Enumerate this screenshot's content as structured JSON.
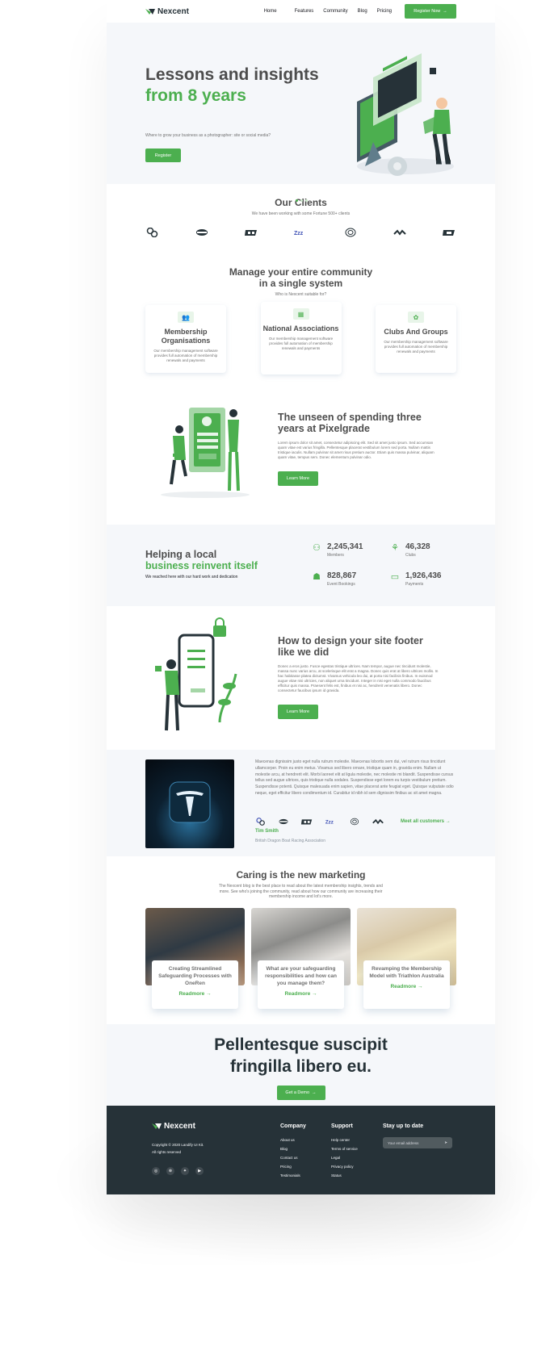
{
  "brand": {
    "name": "Nexcent",
    "accent": "#4caf4f",
    "dark": "#263238"
  },
  "nav": {
    "items": [
      "Home",
      "Features",
      "Community",
      "Blog",
      "Pricing"
    ],
    "cta": "Register Now"
  },
  "hero": {
    "line1": "Lessons and insights",
    "line2": "from 8 years",
    "subtitle": "Where to grow your business as a photographer: site or social media?",
    "button": "Register"
  },
  "clients": {
    "title": "Our Clients",
    "subtitle": "We have been working with some Fortune 500+ clients"
  },
  "community": {
    "title_line1": "Manage your entire community",
    "title_line2": "in a single system",
    "subtitle": "Who is Nexcent suitable for?",
    "cards": [
      {
        "title": "Membership Organisations",
        "desc": "Our membership management software provides full automation of membership renewals and payments"
      },
      {
        "title": "National Associations",
        "desc": "Our membership management software provides full automation of membership renewals and payments"
      },
      {
        "title": "Clubs And Groups",
        "desc": "Our membership management software provides full automation of membership renewals and payments"
      }
    ]
  },
  "feature1": {
    "title": "The unseen of spending three years at Pixelgrade",
    "body": "Lorem ipsum dolor sit amet, consectetur adipiscing elit. Sed sit amet justo ipsum. Sed accumsan quam vitae est varius fringilla. Pellentesque placerat vestibulum lorem sed porta. Nullam mattis tristique iaculis. Nullam pulvinar sit amet risus pretium auctor. Etiam quis massa pulvinar, aliquam quam vitae, tempus sem. Donec elementum pulvinar odio.",
    "button": "Learn More"
  },
  "stats": {
    "title_a": "Helping a local",
    "title_b": "business reinvent itself",
    "subtitle": "We reached here with our hard work and dedication",
    "items": [
      {
        "value": "2,245,341",
        "label": "Members"
      },
      {
        "value": "46,328",
        "label": "Clubs"
      },
      {
        "value": "828,867",
        "label": "Event Bookings"
      },
      {
        "value": "1,926,436",
        "label": "Payments"
      }
    ]
  },
  "feature2": {
    "title": "How to design your site footer like we did",
    "body": "Donec a eros justo. Fusce egestas tristique ultrices. Nam tempor, augue nec tincidunt molestie, massa nunc varius arcu, at scelerisque elit erat a magna. Donec quis erat at libero ultrices mollis. In hac habitasse platea dictumst. Vivamus vehicula leo dui, at porta nisi facilisis finibus. In euismod augue vitae nisi ultricies, non aliquet urna tincidunt. Integer in nisi eget nulla commodo faucibus efficitur quis massa. Praesent felis est, finibus et nisi ac, hendrerit venenatis libero. Donec consectetur faucibus ipsum id gravida.",
    "button": "Learn More"
  },
  "testimonial": {
    "quote": "Maecenas dignissim justo eget nulla rutrum molestie. Maecenas lobortis sem dui, vel rutrum risus tincidunt ullamcorper. Proin eu enim metus. Vivamus sed libero ornare, tristique quam in, gravida enim. Nullam ut molestie arcu, at hendrerit elit. Morbi laoreet elit at ligula molestie, nec molestie mi blandit. Suspendisse cursus tellus sed augue ultrices, quis tristique nulla sodales. Suspendisse eget lorem eu turpis vestibulum pretium. Suspendisse potenti. Quisque malesuada enim sapien, vitae placerat ante feugiat eget. Quisque vulputate odio neque, eget efficitur libero condimentum id. Curabitur id nibh id sem dignissim finibus ac sit amet magna.",
    "name": "Tim Smith",
    "company": "British Dragon Boat Racing Association",
    "link": "Meet all customers"
  },
  "blog": {
    "title": "Caring is the new marketing",
    "subtitle": "The Nexcent blog is the best place to read about the latest membership insights, trends and more. See who's joining the community, read about how our community are increasing their membership income and lot's more.",
    "posts": [
      {
        "title": "Creating Streamlined Safeguarding Processes with OneRen",
        "link": "Readmore"
      },
      {
        "title": "What are your safeguarding responsibilities and how can you manage them?",
        "link": "Readmore"
      },
      {
        "title": "Revamping the Membership Model with Triathlon Australia",
        "link": "Readmore"
      }
    ]
  },
  "cta": {
    "line1": "Pellentesque suscipit",
    "line2": "fringilla libero eu.",
    "button": "Get a Demo"
  },
  "footer": {
    "logo": "Nexcent",
    "copyright": "Copyright © 2020 Landify UI Kit.",
    "rights": "All rights reserved",
    "company": {
      "title": "Company",
      "links": [
        "About us",
        "Blog",
        "Contact us",
        "Pricing",
        "Testimonials"
      ]
    },
    "support": {
      "title": "Support",
      "links": [
        "Help center",
        "Terms of service",
        "Legal",
        "Privacy policy",
        "Status"
      ]
    },
    "newsletter": {
      "title": "Stay up to date",
      "placeholder": "Your email address"
    }
  }
}
